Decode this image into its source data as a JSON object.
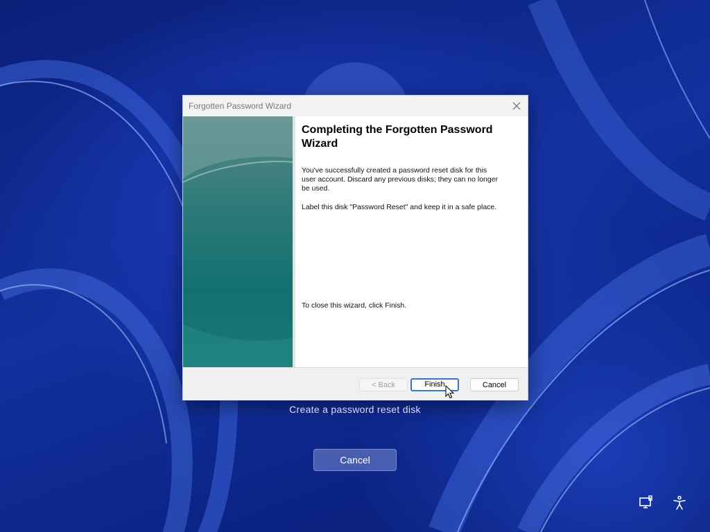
{
  "dialog": {
    "title": "Forgotten Password Wizard",
    "heading": "Completing the Forgotten Password Wizard",
    "paragraph1": "You've successfully created a password reset disk for this user account. Discard any previous disks; they can no longer be used.",
    "paragraph2": "Label this disk \"Password Reset\" and keep it in a safe place.",
    "paragraph3": "To close this wizard, click Finish.",
    "buttons": {
      "back": "< Back",
      "finish": "Finish",
      "cancel": "Cancel"
    }
  },
  "screen": {
    "caption": "Create a password reset disk",
    "cancel_label": "Cancel",
    "tray_icons": [
      "network-icon",
      "accessibility-icon"
    ]
  },
  "colors": {
    "accent": "#3b73c9",
    "sidebar": "#177a78",
    "background": "#12319f"
  }
}
